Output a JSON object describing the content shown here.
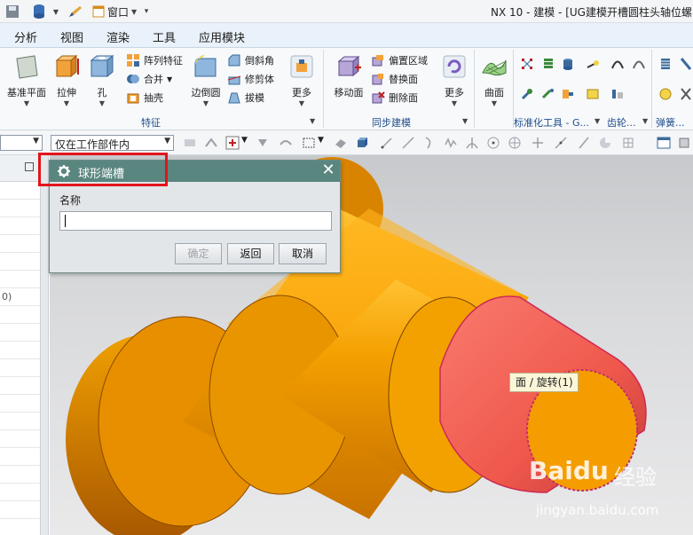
{
  "titlebar": {
    "window_menu": "窗口",
    "app_title": "NX 10 - 建模 - [UG建模开槽圆柱头轴位螺"
  },
  "menubar": {
    "items": [
      "分析",
      "视图",
      "渲染",
      "工具",
      "应用模块"
    ]
  },
  "ribbon": {
    "feature": {
      "big": [
        "基准平面",
        "拉伸",
        "孔",
        "边倒圆"
      ],
      "small": [
        "阵列特征",
        "合并",
        "抽壳",
        "倒斜角",
        "修剪体",
        "拔模"
      ],
      "more": "更多",
      "group_label": "特征"
    },
    "sync": {
      "big": [
        "移动面"
      ],
      "small": [
        "偏置区域",
        "替换面",
        "删除面"
      ],
      "more": "更多",
      "group_label": "同步建模"
    },
    "surface": {
      "big": "曲面"
    },
    "std_group_label": "标准化工具 - G...",
    "gear_group_label": "齿轮...",
    "spring_group_label": "弹簧..."
  },
  "selection_bar": {
    "filter_value": "仅在工作部件内"
  },
  "navigator": {
    "partial_row_text": "0)"
  },
  "dialog": {
    "title": "球形端槽",
    "name_label": "名称",
    "name_value": "",
    "ok_label": "确定",
    "back_label": "返回",
    "cancel_label": "取消"
  },
  "tooltip": {
    "text": "面 / 旋转(1)"
  },
  "watermark": {
    "brand": "Baidu",
    "brand_cn": "经验",
    "url": "jingyan.baidu.com"
  },
  "colors": {
    "part_orange": "#f5a000",
    "highlight_face": "#f4675a",
    "dialog_title_bg": "#5a8680",
    "highlight_box": "#e3141b"
  }
}
